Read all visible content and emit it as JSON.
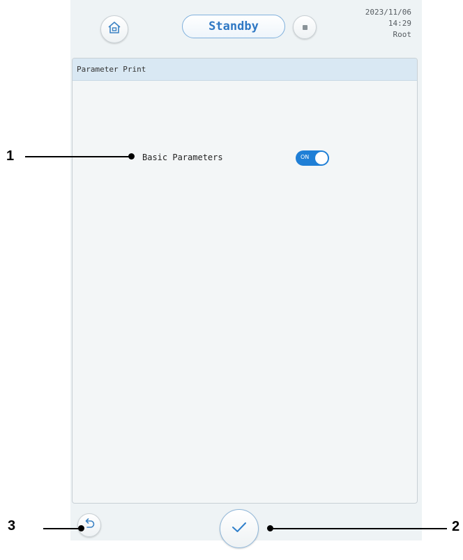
{
  "header": {
    "status_label": "Standby",
    "date": "2023/11/06",
    "time": "14:29",
    "user": "Root",
    "home_icon": "home-icon",
    "stop_icon": "stop-icon"
  },
  "panel": {
    "title": "Parameter Print",
    "items": [
      {
        "label": "Basic Parameters",
        "toggle_text": "ON",
        "toggle_state": true
      }
    ]
  },
  "footer": {
    "back_icon": "back-arrow-icon",
    "confirm_icon": "checkmark-icon"
  },
  "callouts": [
    "1",
    "2",
    "3"
  ],
  "colors": {
    "accent": "#1f7fd6",
    "status_text": "#2f78c4",
    "panel_header": "#d9e8f3",
    "screen_bg": "#eef3f5"
  }
}
